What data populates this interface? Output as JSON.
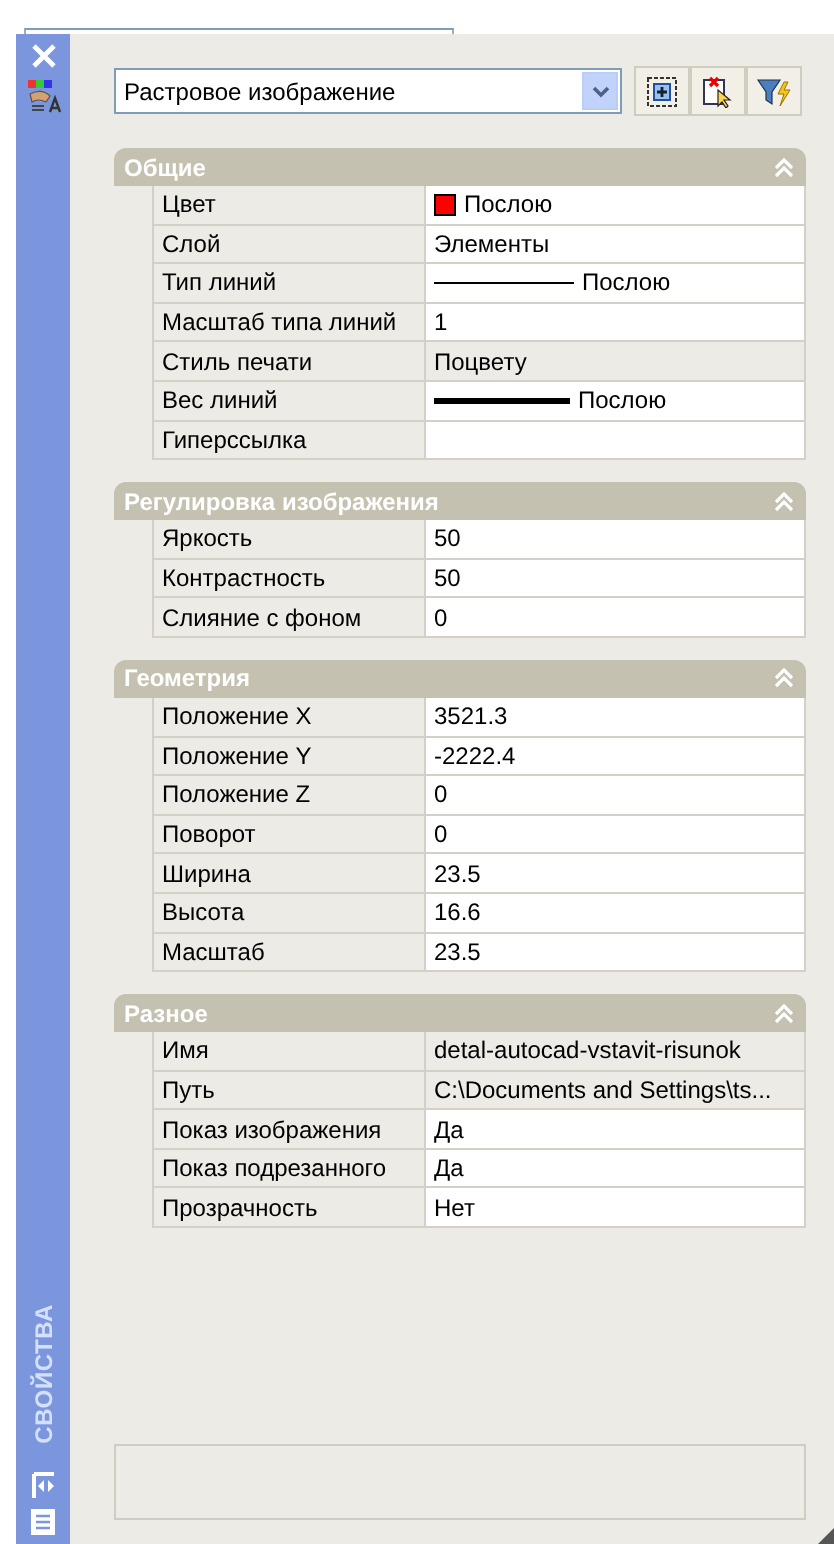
{
  "sidebar": {
    "title": "СВОЙСТВА"
  },
  "object_selector": {
    "value": "Растровое изображение"
  },
  "sections": [
    {
      "title": "Общие",
      "expanded": true,
      "rows": [
        {
          "label": "Цвет",
          "value": "Послою",
          "kind": "color",
          "color": "#ff0000"
        },
        {
          "label": "Слой",
          "value": "Элементы",
          "kind": "text"
        },
        {
          "label": "Тип линий",
          "value": "Послою",
          "kind": "linetype"
        },
        {
          "label": "Масштаб типа линий",
          "value": "1",
          "kind": "text"
        },
        {
          "label": "Стиль печати",
          "value": "Поцвету",
          "kind": "text",
          "disabled": true
        },
        {
          "label": "Вес линий",
          "value": "Послою",
          "kind": "lineweight"
        },
        {
          "label": "Гиперссылка",
          "value": "",
          "kind": "text"
        }
      ]
    },
    {
      "title": "Регулировка изображения",
      "expanded": true,
      "rows": [
        {
          "label": "Яркость",
          "value": "50",
          "kind": "text"
        },
        {
          "label": "Контрастность",
          "value": "50",
          "kind": "text"
        },
        {
          "label": "Слияние с фоном",
          "value": "0",
          "kind": "text"
        }
      ]
    },
    {
      "title": "Геометрия",
      "expanded": true,
      "rows": [
        {
          "label": "Положение X",
          "value": "3521.3",
          "kind": "text"
        },
        {
          "label": "Положение Y",
          "value": "-2222.4",
          "kind": "text"
        },
        {
          "label": "Положение Z",
          "value": "0",
          "kind": "text"
        },
        {
          "label": "Поворот",
          "value": "0",
          "kind": "text"
        },
        {
          "label": "Ширина",
          "value": "23.5",
          "kind": "text"
        },
        {
          "label": "Высота",
          "value": "16.6",
          "kind": "text"
        },
        {
          "label": "Масштаб",
          "value": "23.5",
          "kind": "text"
        }
      ]
    },
    {
      "title": "Разное",
      "expanded": true,
      "rows": [
        {
          "label": "Имя",
          "value": "detal-autocad-vstavit-risunok",
          "kind": "text",
          "disabled": true
        },
        {
          "label": "Путь",
          "value": "C:\\Documents and Settings\\ts...",
          "kind": "text",
          "disabled": true
        },
        {
          "label": "Показ изображения",
          "value": "Да",
          "kind": "text"
        },
        {
          "label": "Показ подрезанного",
          "value": "Да",
          "kind": "text"
        },
        {
          "label": "Прозрачность",
          "value": "Нет",
          "kind": "text"
        }
      ]
    }
  ]
}
